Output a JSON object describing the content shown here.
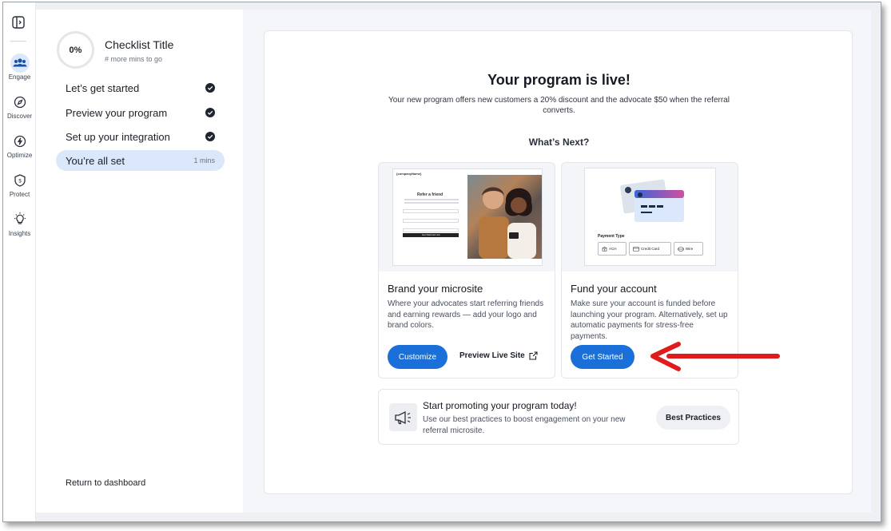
{
  "nav": {
    "items": [
      {
        "label": "Engage",
        "icon": "users-icon",
        "active": true
      },
      {
        "label": "Discover",
        "icon": "compass-icon"
      },
      {
        "label": "Optimize",
        "icon": "bolt-icon"
      },
      {
        "label": "Protect",
        "icon": "shield-icon"
      },
      {
        "label": "Insights",
        "icon": "lightbulb-icon"
      }
    ]
  },
  "checklist": {
    "progress": "0%",
    "title": "Checklist Title",
    "subtitle": "# more mins to go",
    "steps": [
      {
        "label": "Let’s get started",
        "done": true
      },
      {
        "label": "Preview your program",
        "done": true
      },
      {
        "label": "Set up your integration",
        "done": true
      },
      {
        "label": "You’re all set",
        "done": false,
        "meta": "1 mins"
      }
    ],
    "return_label": "Return to dashboard"
  },
  "main": {
    "title": "Your program is live!",
    "description": "Your new program offers new customers a 20% discount and the advocate $50 when the referral converts.",
    "next_heading": "What’s Next?",
    "microsite": {
      "company": "{companyName}",
      "heading": "Refer a friend",
      "button": "Get Referral Link",
      "title": "Brand your microsite",
      "description": "Where your advocates start referring friends and earning rewards — add your logo and brand colors.",
      "primary_label": "Customize",
      "secondary_label": "Preview Live Site"
    },
    "fund": {
      "payment_type_label": "Payment Type",
      "options": [
        "ACH",
        "Credit Card",
        "Wire"
      ],
      "title": "Fund your account",
      "description": "Make sure your account is funded before launching your program. Alternatively, set up automatic payments for stress-free payments.",
      "primary_label": "Get Started"
    },
    "promo": {
      "title": "Start promoting your program today!",
      "description": "Use our best practices to boost engagement on your new referral microsite.",
      "button_label": "Best Practices"
    }
  },
  "colors": {
    "accent": "#1a6fd8",
    "highlight": "#dbe8fb",
    "annotation_arrow": "#e01b1b"
  }
}
